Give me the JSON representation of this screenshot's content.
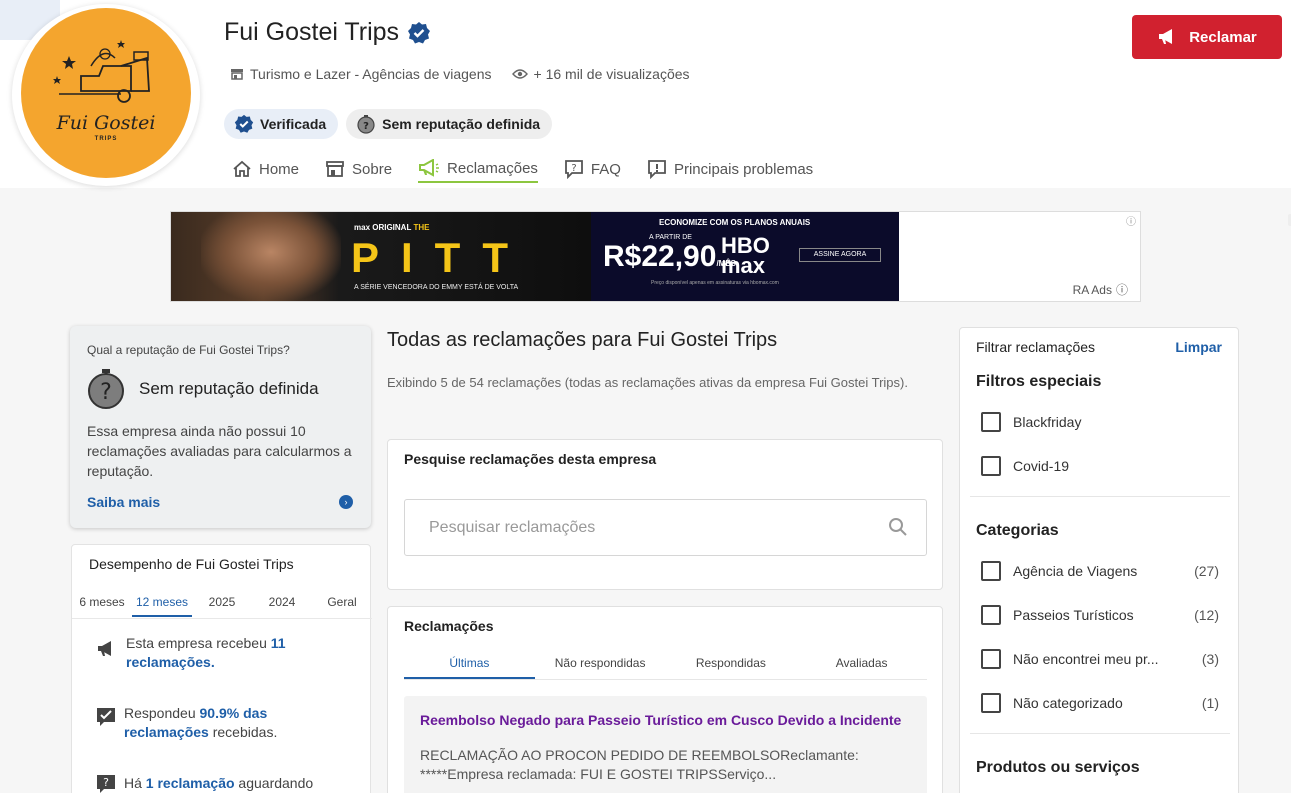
{
  "company": {
    "name": "Fui Gostei Trips",
    "logo_text": "Fui Gostei",
    "logo_sub": "TRIPS",
    "category": "Turismo e Lazer - Agências de viagens",
    "views": "+ 16 mil de visualizações",
    "badge_verified": "Verificada",
    "badge_reputation": "Sem reputação definida"
  },
  "nav": [
    {
      "label": "Home"
    },
    {
      "label": "Sobre"
    },
    {
      "label": "Reclamações"
    },
    {
      "label": "FAQ"
    },
    {
      "label": "Principais problemas"
    }
  ],
  "actions": {
    "reclamar": "Reclamar"
  },
  "ad": {
    "hbo_tag": "max ORIGINAL",
    "title": "PITT",
    "prefix": "THE",
    "tagline": "A SÉRIE VENCEDORA DO EMMY ESTÁ DE VOLTA",
    "econ": "ECONOMIZE COM OS PLANOS ANUAIS",
    "a_partir": "A PARTIR DE",
    "price": "R$22,90",
    "per": "/MÊS",
    "brand": "HBO max",
    "cta": "ASSINE AGORA",
    "fine": "Preço disponível apenas em assinaturas via hbomax.com",
    "label": "RA Ads"
  },
  "reputation": {
    "question": "Qual a reputação de Fui Gostei Trips?",
    "title": "Sem reputação definida",
    "description": "Essa empresa ainda não possui 10 reclamações avaliadas para calcularmos a reputação.",
    "link": "Saiba mais"
  },
  "performance": {
    "title": "Desempenho de Fui Gostei Trips",
    "tabs": [
      "6 meses",
      "12 meses",
      "2025",
      "2024",
      "Geral"
    ],
    "received_pre": "Esta empresa recebeu",
    "received_val": "11 reclamações.",
    "responded_pre": "Respondeu",
    "responded_val": "90.9% das reclamações",
    "responded_post": "recebidas.",
    "waiting_pre": "Há",
    "waiting_val": "1 reclamação",
    "waiting_post": "aguardando"
  },
  "main": {
    "title": "Todas as reclamações para Fui Gostei Trips",
    "description": "Exibindo 5 de 54 reclamações (todas as reclamações ativas da empresa Fui Gostei Trips).",
    "search_title": "Pesquise reclamações desta empresa",
    "search_placeholder": "Pesquisar reclamações",
    "complaints_title": "Reclamações",
    "tabs": [
      "Últimas",
      "Não respondidas",
      "Respondidas",
      "Avaliadas"
    ],
    "first_item": {
      "title": "Reembolso Negado para Passeio Turístico em Cusco Devido a Incidente",
      "body": "RECLAMAÇÃO AO PROCON PEDIDO DE REEMBOLSOReclamante: *****Empresa reclamada: FUI E GOSTEI TRIPSServiço..."
    }
  },
  "filters": {
    "title": "Filtrar reclamações",
    "clear": "Limpar",
    "special_title": "Filtros especiais",
    "special": [
      {
        "label": "Blackfriday"
      },
      {
        "label": "Covid-19"
      }
    ],
    "categories_title": "Categorias",
    "categories": [
      {
        "label": "Agência de Viagens",
        "count": "(27)"
      },
      {
        "label": "Passeios Turísticos",
        "count": "(12)"
      },
      {
        "label": "Não encontrei meu pr...",
        "count": "(3)"
      },
      {
        "label": "Não categorizado",
        "count": "(1)"
      }
    ],
    "products_title": "Produtos ou serviços"
  },
  "colors": {
    "accent": "#1f5fa8",
    "cta": "#d1212f",
    "nav_active": "#8cc63f",
    "logo_bg": "#f4a52e"
  }
}
